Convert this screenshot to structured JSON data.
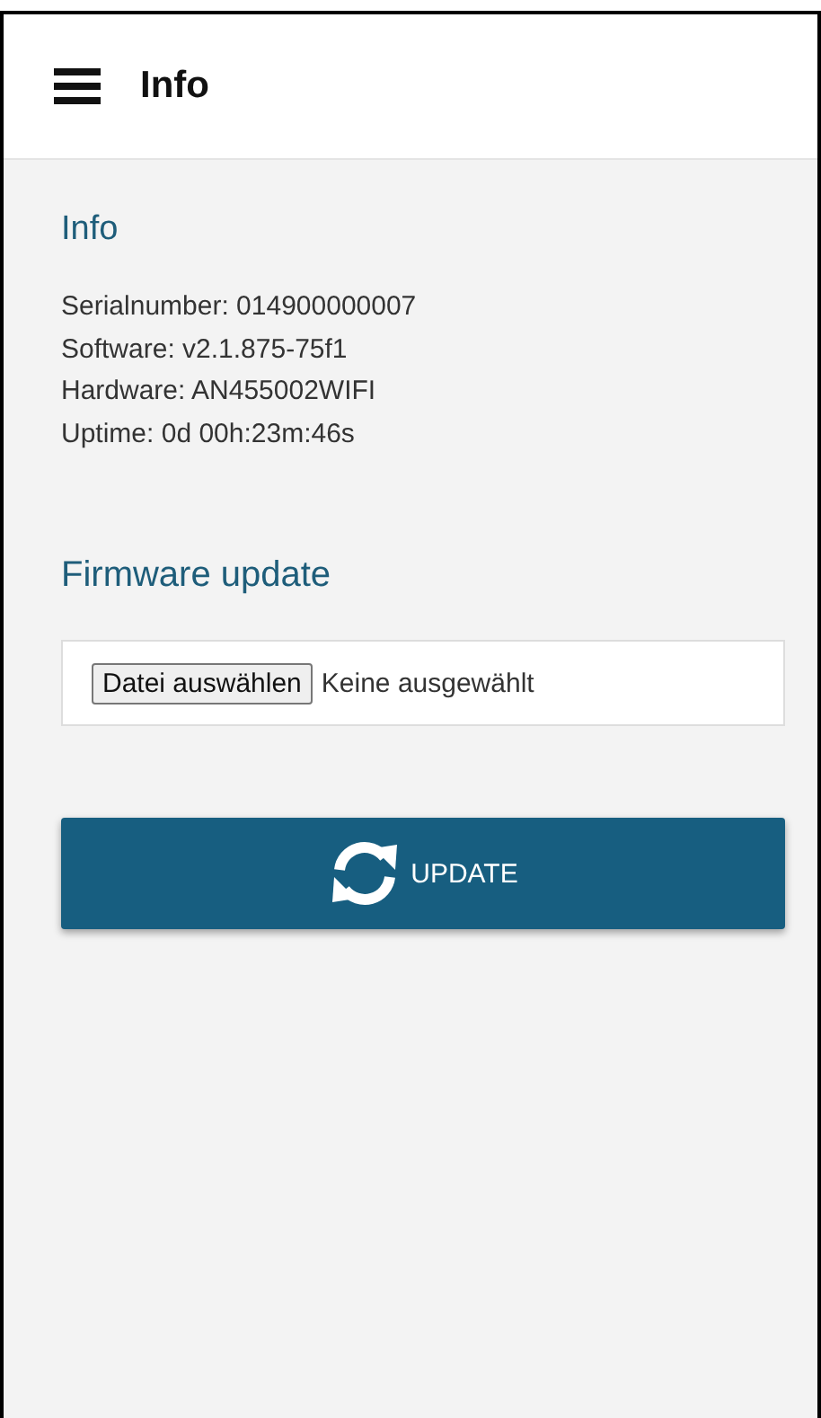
{
  "header": {
    "title": "Info"
  },
  "info_section": {
    "heading": "Info",
    "lines": [
      "Serialnumber: 014900000007",
      "Software: v2.1.875-75f1",
      "Hardware: AN455002WIFI",
      "Uptime: 0d 00h:23m:46s"
    ]
  },
  "firmware_section": {
    "heading": "Firmware update",
    "file_button": "Datei auswählen",
    "file_status": "Keine ausgewählt",
    "update_button": "UPDATE"
  }
}
